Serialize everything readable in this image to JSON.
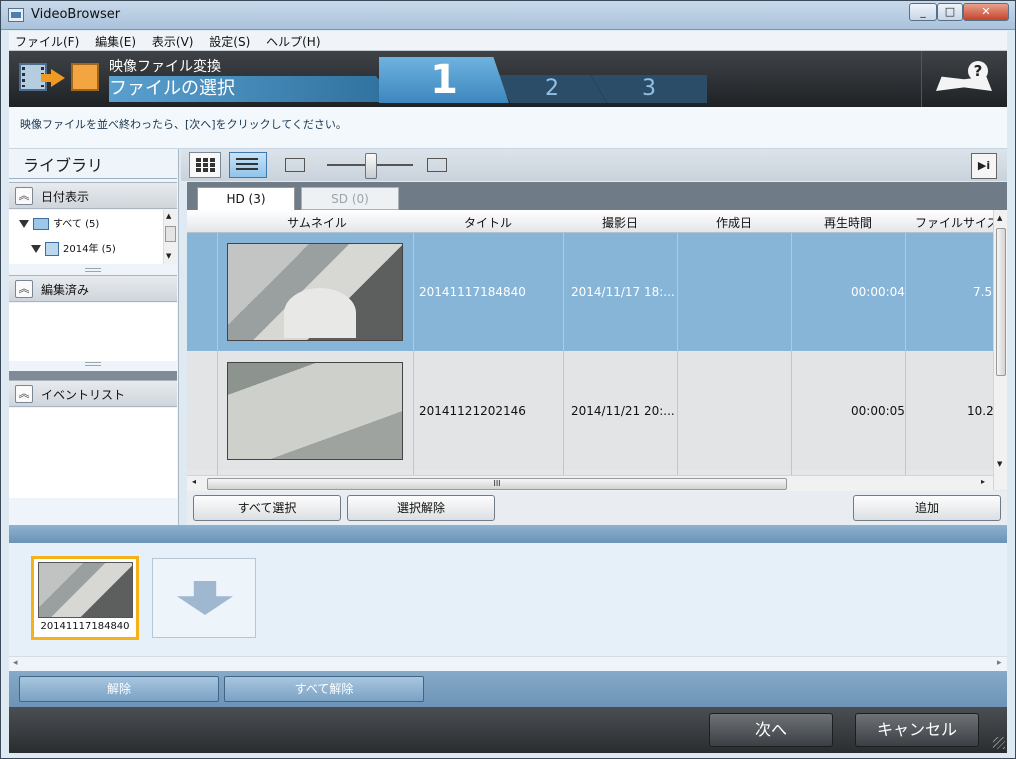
{
  "window": {
    "title": "VideoBrowser",
    "controls": [
      "_",
      "□",
      "✕"
    ]
  },
  "menu": [
    "ファイル(F)",
    "編集(E)",
    "表示(V)",
    "設定(S)",
    "ヘルプ(H)"
  ],
  "header": {
    "subtitle": "映像ファイル変換",
    "title": "ファイルの選択",
    "steps": [
      "1",
      "2",
      "3"
    ]
  },
  "instruction": "映像ファイルを並べ終わったら、[次へ]をクリックしてください。",
  "library": {
    "title": "ライブラリ",
    "date_section": "日付表示",
    "tree": [
      {
        "label": "すべて (5)"
      },
      {
        "label": "2014年 (5)"
      }
    ],
    "edited_section": "編集済み",
    "event_section": "イベントリスト"
  },
  "tabs": [
    {
      "label": "HD (3)",
      "active": true
    },
    {
      "label": "SD (0)",
      "active": false
    }
  ],
  "columns": [
    "サムネイル",
    "タイトル",
    "撮影日",
    "作成日",
    "再生時間",
    "ファイルサイズ"
  ],
  "rows": [
    {
      "title": "20141117184840",
      "shot": "2014/11/17 18:...",
      "created": "",
      "duration": "00:00:04",
      "size": "7.5",
      "selected": true
    },
    {
      "title": "20141121202146",
      "shot": "2014/11/21 20:...",
      "created": "",
      "duration": "00:00:05",
      "size": "10.2",
      "selected": false
    }
  ],
  "scroll_grip": "III",
  "buttons": {
    "select_all": "すべて選択",
    "deselect": "選択解除",
    "add": "追加"
  },
  "queue": {
    "item_label": "20141117184840",
    "left_arrow": "◂",
    "right_arrow": "▸"
  },
  "queue_buttons": {
    "release": "解除",
    "release_all": "すべて解除"
  },
  "footer": {
    "next": "次へ",
    "cancel": "キャンセル"
  },
  "icons": {
    "info_button": "▶i"
  }
}
